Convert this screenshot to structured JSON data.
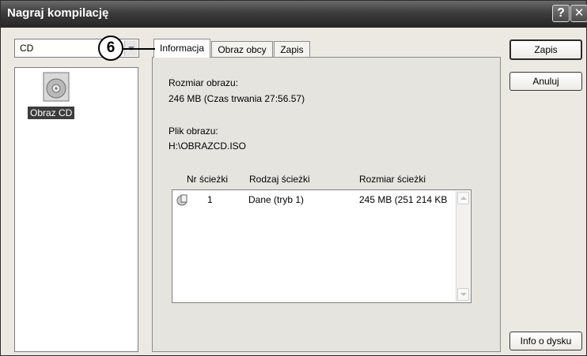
{
  "window": {
    "title": "Nagraj kompilację",
    "help_label": "?",
    "close_label": "✕"
  },
  "callout": {
    "number": "6"
  },
  "cd_selector": {
    "value": "CD"
  },
  "left_panel": {
    "items": [
      {
        "label": "Obraz CD",
        "icon": "cd-image-icon",
        "selected": true
      }
    ]
  },
  "tabs": [
    {
      "label": "Informacja",
      "active": true
    },
    {
      "label": "Obraz obcy",
      "active": false
    },
    {
      "label": "Zapis",
      "active": false
    }
  ],
  "info": {
    "image_size_label": "Rozmiar obrazu:",
    "image_size_value": "246 MB (Czas trwania 27:56.57)",
    "image_file_label": "Plik obrazu:",
    "image_file_value": "H:\\OBRAZCD.ISO"
  },
  "tracks": {
    "headers": [
      "Nr ścieżki",
      "Rodzaj ścieżki",
      "Rozmiar ścieżki"
    ],
    "rows": [
      {
        "number": "1",
        "type": "Dane (tryb 1)",
        "size": "245 MB (251 214 KB"
      }
    ]
  },
  "buttons": {
    "zapis": "Zapis",
    "anuluj": "Anuluj",
    "info": "Info o dysku"
  },
  "colors": {
    "titlebar": "#3c3c3c",
    "dialog_bg": "#ece9e3",
    "selection": "#3c3c3c"
  }
}
